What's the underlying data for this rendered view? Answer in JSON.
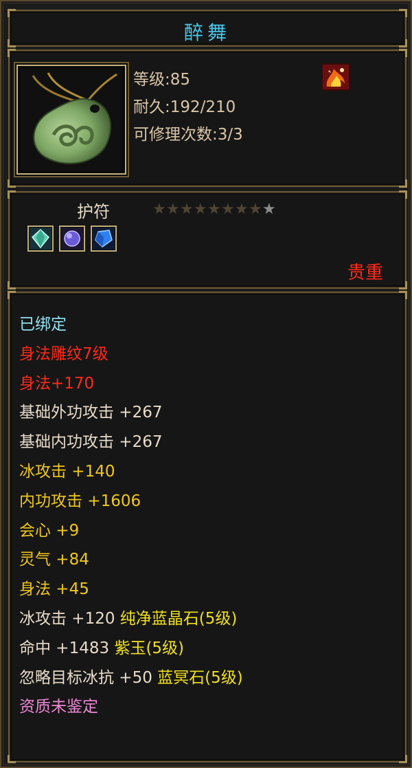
{
  "item_name": "醉舞",
  "stats": {
    "level": "等级:85",
    "durability": "耐久:192/210",
    "repairs": "可修理次数:3/3"
  },
  "item_type": "护符",
  "stars": {
    "total": 9,
    "lit": 1
  },
  "gem_slots": [
    "green-gem-icon",
    "purple-gem-icon",
    "blue-gem-icon"
  ],
  "rarity": "贵重",
  "colors": {
    "title": "#48c6ea",
    "bound": "#8fe0f0",
    "red": "#ff2a1a",
    "white": "#e8dccb",
    "yellow": "#f0c81e",
    "gem_name": "#f0e020",
    "pink": "#ee88d6"
  },
  "attributes": [
    {
      "parts": [
        {
          "text": "已绑定",
          "color": "bound"
        }
      ]
    },
    {
      "parts": [
        {
          "text": "身法雕纹7级",
          "color": "red"
        }
      ]
    },
    {
      "parts": [
        {
          "text": "身法+170",
          "color": "red"
        }
      ]
    },
    {
      "parts": [
        {
          "text": "基础外功攻击 +267",
          "color": "white"
        }
      ]
    },
    {
      "parts": [
        {
          "text": "基础内功攻击 +267",
          "color": "white"
        }
      ]
    },
    {
      "parts": [
        {
          "text": "冰攻击 +140",
          "color": "yellow"
        }
      ]
    },
    {
      "parts": [
        {
          "text": "内功攻击 +1606",
          "color": "yellow"
        }
      ]
    },
    {
      "parts": [
        {
          "text": "会心 +9",
          "color": "yellow"
        }
      ]
    },
    {
      "parts": [
        {
          "text": "灵气 +84",
          "color": "yellow"
        }
      ]
    },
    {
      "parts": [
        {
          "text": "身法 +45",
          "color": "yellow"
        }
      ]
    },
    {
      "parts": [
        {
          "text": "冰攻击 +120 ",
          "color": "white"
        },
        {
          "text": "纯净蓝晶石(5级)",
          "color": "gem_name"
        }
      ]
    },
    {
      "parts": [
        {
          "text": "命中 +1483 ",
          "color": "white"
        },
        {
          "text": "紫玉(5级)",
          "color": "gem_name"
        }
      ]
    },
    {
      "parts": [
        {
          "text": "忽略目标冰抗 +50 ",
          "color": "white"
        },
        {
          "text": "蓝冥石(5级)",
          "color": "gem_name"
        }
      ]
    },
    {
      "parts": [
        {
          "text": "资质未鉴定",
          "color": "pink"
        }
      ]
    }
  ]
}
